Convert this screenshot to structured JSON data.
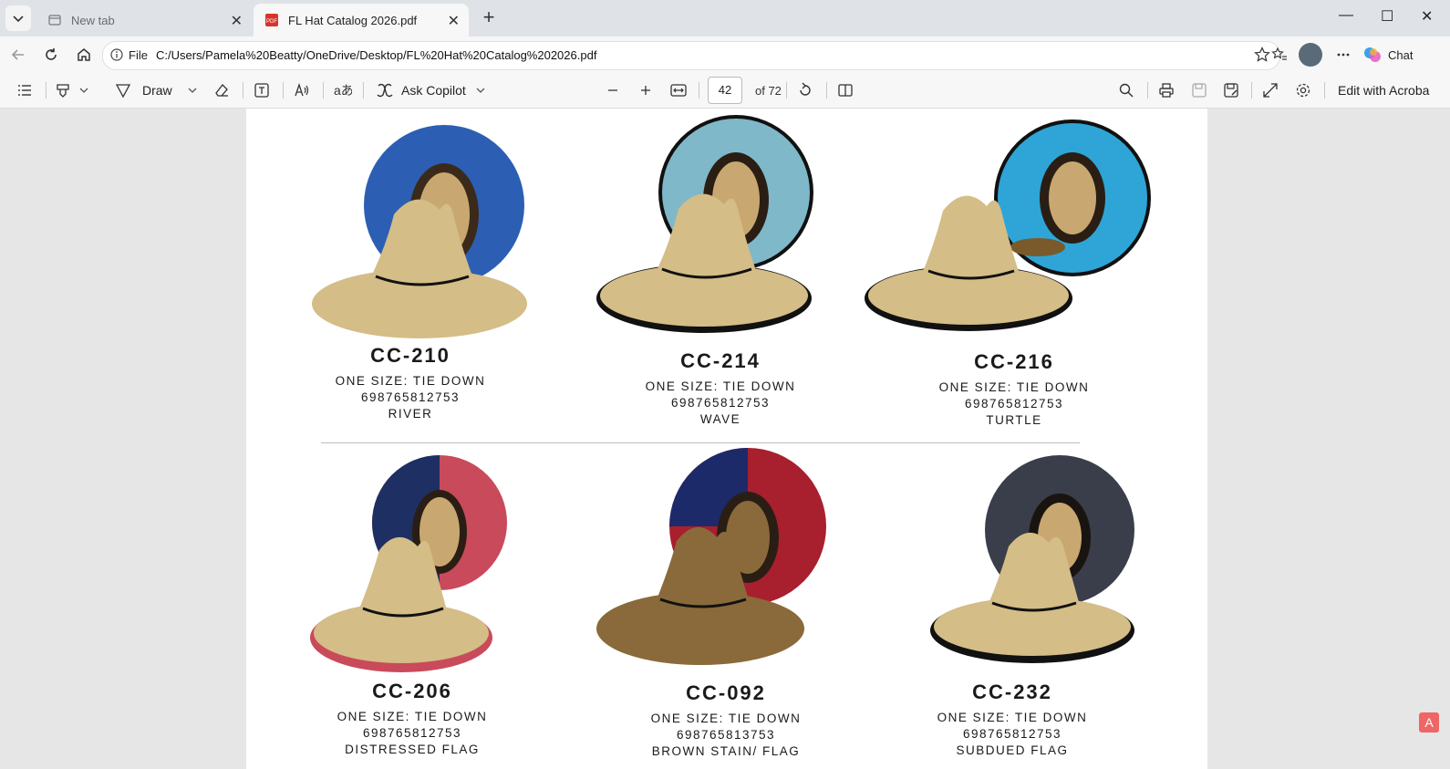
{
  "tabs": [
    {
      "label": "New tab",
      "active": false
    },
    {
      "label": "FL Hat Catalog 2026.pdf",
      "active": true
    }
  ],
  "address": {
    "scheme": "File",
    "url": "C:/Users/Pamela%20Beatty/OneDrive/Desktop/FL%20Hat%20Catalog%202026.pdf"
  },
  "browser": {
    "chat_label": "Chat"
  },
  "pdf_toolbar": {
    "draw_label": "Draw",
    "copilot_label": "Ask Copilot",
    "page_current": "42",
    "page_total": "of 72",
    "edit_label": "Edit with Acroba"
  },
  "products": [
    {
      "code": "CC-210",
      "size": "ONE SIZE: TIE DOWN",
      "upc": "698765812753",
      "name": "RIVER",
      "lining_color": "#2c5fb3"
    },
    {
      "code": "CC-214",
      "size": "ONE SIZE: TIE DOWN",
      "upc": "698765812753",
      "name": "WAVE",
      "lining_color": "#7fb8c9"
    },
    {
      "code": "CC-216",
      "size": "ONE SIZE: TIE DOWN",
      "upc": "698765812753",
      "name": "TURTLE",
      "lining_color": "#2ea5d6"
    },
    {
      "code": "CC-206",
      "size": "ONE SIZE: TIE DOWN",
      "upc": "698765812753",
      "name": "DISTRESSED FLAG",
      "lining_color": "#c94a5a"
    },
    {
      "code": "CC-092",
      "size": "ONE SIZE: TIE DOWN",
      "upc": "698765813753",
      "name": "BROWN STAIN/ FLAG",
      "lining_color": "#a81f2e"
    },
    {
      "code": "CC-232",
      "size": "ONE SIZE: TIE DOWN",
      "upc": "698765812753",
      "name": "SUBDUED FLAG",
      "lining_color": "#3a3d4a"
    }
  ],
  "colors": {
    "straw": "#d4bd86",
    "straw_dark": "#8a6a3a",
    "toolbar": "#f7f7f7",
    "tabbar": "#dfe3e8"
  }
}
